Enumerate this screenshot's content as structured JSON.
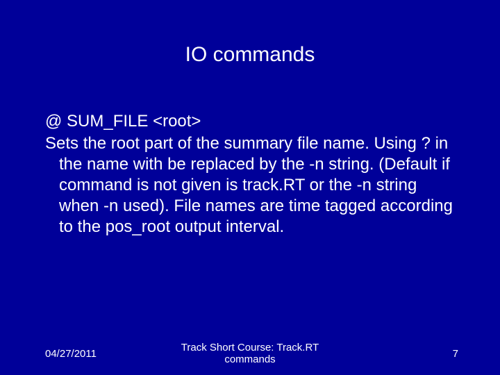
{
  "title": "IO commands",
  "body": {
    "command": "@ SUM_FILE <root>",
    "description": "Sets the root part of the summary file name. Using ? in the name with be replaced by the -n string.  (Default if command is not given is track.RT or the -n string when -n used).  File names are time tagged according to the pos_root output interval."
  },
  "footer": {
    "date": "04/27/2011",
    "center_line1": "Track Short Course: Track.RT",
    "center_line2": "commands",
    "page": "7"
  }
}
